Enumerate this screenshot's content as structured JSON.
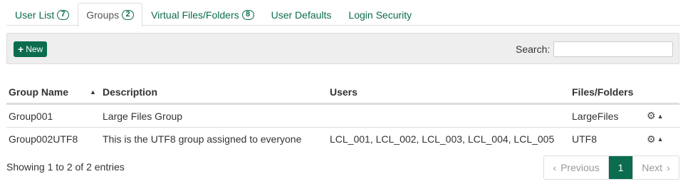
{
  "tabs": [
    {
      "label": "User List",
      "badge": "7",
      "active": false
    },
    {
      "label": "Groups",
      "badge": "2",
      "active": true
    },
    {
      "label": "Virtual Files/Folders",
      "badge": "8",
      "active": false
    },
    {
      "label": "User Defaults",
      "badge": null,
      "active": false
    },
    {
      "label": "Login Security",
      "badge": null,
      "active": false
    }
  ],
  "toolbar": {
    "new_label": "New",
    "new_icon": "plus-icon",
    "search_label": "Search:",
    "search_value": ""
  },
  "table": {
    "columns": [
      "Group Name",
      "Description",
      "Users",
      "Files/Folders"
    ],
    "sort_icon": "sort-asc-icon",
    "rows": [
      {
        "name": "Group001",
        "description": "Large Files Group",
        "users": "",
        "files": "LargeFiles"
      },
      {
        "name": "Group002UTF8",
        "description": "This is the UTF8 group assigned to everyone",
        "users": "LCL_001, LCL_002, LCL_003, LCL_004, LCL_005",
        "files": "UTF8"
      }
    ],
    "row_action_icons": [
      "gear-icon",
      "caret-up-icon"
    ]
  },
  "footer": {
    "info": "Showing 1 to 2 of 2 entries",
    "prev_label": "Previous",
    "current_page": "1",
    "next_label": "Next"
  },
  "colors": {
    "accent": "#0b6c4f",
    "border": "#dddddd",
    "toolbar_bg": "#eeeeee"
  }
}
